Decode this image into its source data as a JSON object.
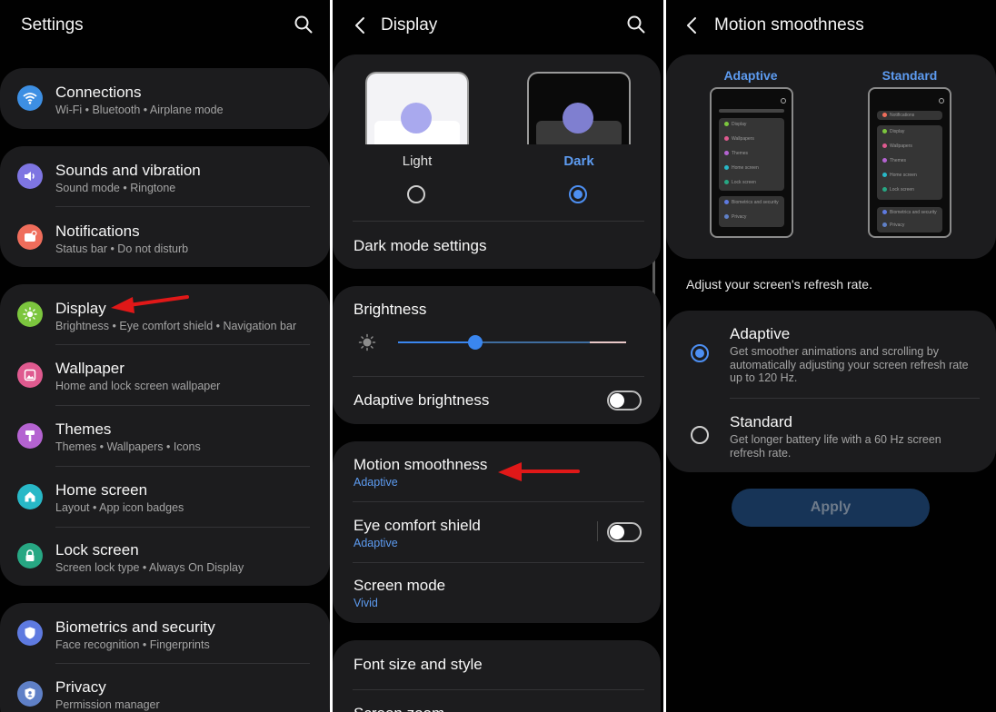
{
  "settings": {
    "title": "Settings",
    "items": [
      {
        "label": "Connections",
        "sub": "Wi-Fi  •  Bluetooth  •  Airplane mode",
        "icon": "wifi-icon",
        "color": "#3d8fe3"
      },
      {
        "label": "Sounds and vibration",
        "sub": "Sound mode  •  Ringtone",
        "icon": "speaker-icon",
        "color": "#7e75e2"
      },
      {
        "label": "Notifications",
        "sub": "Status bar  •  Do not disturb",
        "icon": "notification-icon",
        "color": "#ef6d5b"
      },
      {
        "label": "Display",
        "sub": "Brightness  •  Eye comfort shield  •  Navigation bar",
        "icon": "sun-icon",
        "color": "#7cc63e"
      },
      {
        "label": "Wallpaper",
        "sub": "Home and lock screen wallpaper",
        "icon": "image-icon",
        "color": "#df5a8f"
      },
      {
        "label": "Themes",
        "sub": "Themes  •  Wallpapers  •  Icons",
        "icon": "brush-icon",
        "color": "#b463d1"
      },
      {
        "label": "Home screen",
        "sub": "Layout  •  App icon badges",
        "icon": "home-icon",
        "color": "#28b8c7"
      },
      {
        "label": "Lock screen",
        "sub": "Screen lock type  •  Always On Display",
        "icon": "lock-icon",
        "color": "#27a783"
      },
      {
        "label": "Biometrics and security",
        "sub": "Face recognition  •  Fingerprints",
        "icon": "shield-icon",
        "color": "#5e7ae0"
      },
      {
        "label": "Privacy",
        "sub": "Permission manager",
        "icon": "privacy-icon",
        "color": "#5f80c7"
      }
    ]
  },
  "display": {
    "title": "Display",
    "light_label": "Light",
    "dark_label": "Dark",
    "selected_mode": "dark",
    "dark_mode_settings": "Dark mode settings",
    "brightness_label": "Brightness",
    "brightness_level": 0.34,
    "adaptive_brightness": "Adaptive brightness",
    "adaptive_brightness_on": false,
    "motion_smoothness": "Motion smoothness",
    "motion_smoothness_value": "Adaptive",
    "eye_comfort": "Eye comfort shield",
    "eye_comfort_value": "Adaptive",
    "eye_comfort_on": false,
    "screen_mode": "Screen mode",
    "screen_mode_value": "Vivid",
    "font_size": "Font size and style",
    "screen_zoom": "Screen zoom"
  },
  "motion": {
    "title": "Motion smoothness",
    "preview_adaptive": "Adaptive",
    "preview_standard": "Standard",
    "preview_items": [
      "Notifications",
      "Display",
      "Wallpapers",
      "Themes",
      "Home screen",
      "Lock screen",
      "Biometrics and security",
      "Privacy"
    ],
    "description": "Adjust your screen's refresh rate.",
    "options": [
      {
        "label": "Adaptive",
        "desc": "Get smoother animations and scrolling by automatically adjusting your screen refresh rate up to 120 Hz.",
        "selected": true
      },
      {
        "label": "Standard",
        "desc": "Get longer battery life with a 60 Hz screen refresh rate.",
        "selected": false
      }
    ],
    "apply_label": "Apply"
  },
  "colors": {
    "background": "#010101",
    "card": "#1c1c1e",
    "accent": "#4d8ff2",
    "arrow": "#e01818"
  }
}
